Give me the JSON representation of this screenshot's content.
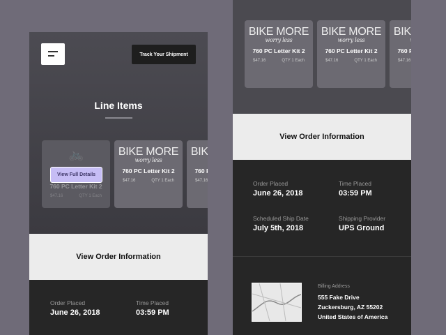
{
  "header": {
    "track_label": "Track Your Shipment",
    "title": "Line Items"
  },
  "products": [
    {
      "brand": "BIKE MORE",
      "tagline": "worry less",
      "name": "760 PC Letter Kit 2",
      "price": "$47.16",
      "qty": "QTY 1 Each"
    }
  ],
  "view_details_label": "View Full Details",
  "order_info_label": "View Order Information",
  "order": {
    "order_placed_label": "Order Placed",
    "order_placed": "June 26, 2018",
    "time_placed_label": "Time Placed",
    "time_placed": "03:59 PM",
    "ship_date_label": "Scheduled Ship Date",
    "ship_date": "July 5th, 2018",
    "provider_label": "Shipping Provider",
    "provider": "UPS Ground"
  },
  "billing": {
    "label": "Billing Address",
    "line1": "555 Fake Drive",
    "line2": "Zuckersburg, AZ 55202",
    "line3": "United States of America"
  },
  "colors": {
    "accent": "#c6bdf5",
    "dark": "#262626",
    "band": "#ececec"
  }
}
